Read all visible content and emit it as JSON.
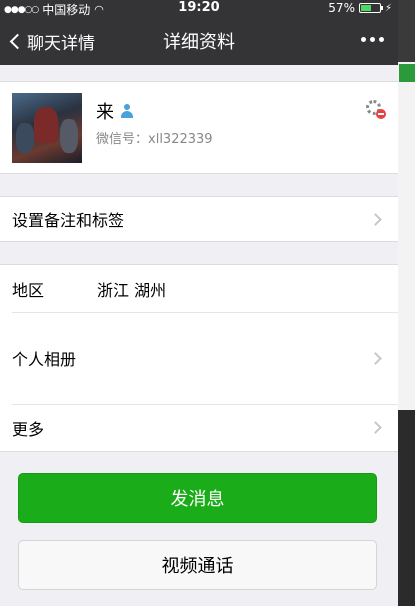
{
  "status_bar": {
    "signal_dots": "●●●○○",
    "carrier": "中国移动",
    "wifi_icon": "wifi-icon",
    "time": "19:20",
    "battery_percent": "57%",
    "battery_level": 0.57,
    "charging_icon": "⚡"
  },
  "nav": {
    "back_label": "聊天详情",
    "title": "详细资料",
    "more_icon": "more-dots-icon"
  },
  "profile": {
    "name": "来",
    "wechat_id_label": "微信号：",
    "wechat_id": "xll322339"
  },
  "rows": {
    "remark_label": "设置备注和标签",
    "region_label": "地区",
    "region_value": "浙江 湖州",
    "album_label": "个人相册",
    "more_label": "更多"
  },
  "buttons": {
    "send_message": "发消息",
    "video_call": "视频通话"
  },
  "colors": {
    "nav_bg": "#343437",
    "primary_green": "#1aad19",
    "page_bg": "#efeff4"
  }
}
